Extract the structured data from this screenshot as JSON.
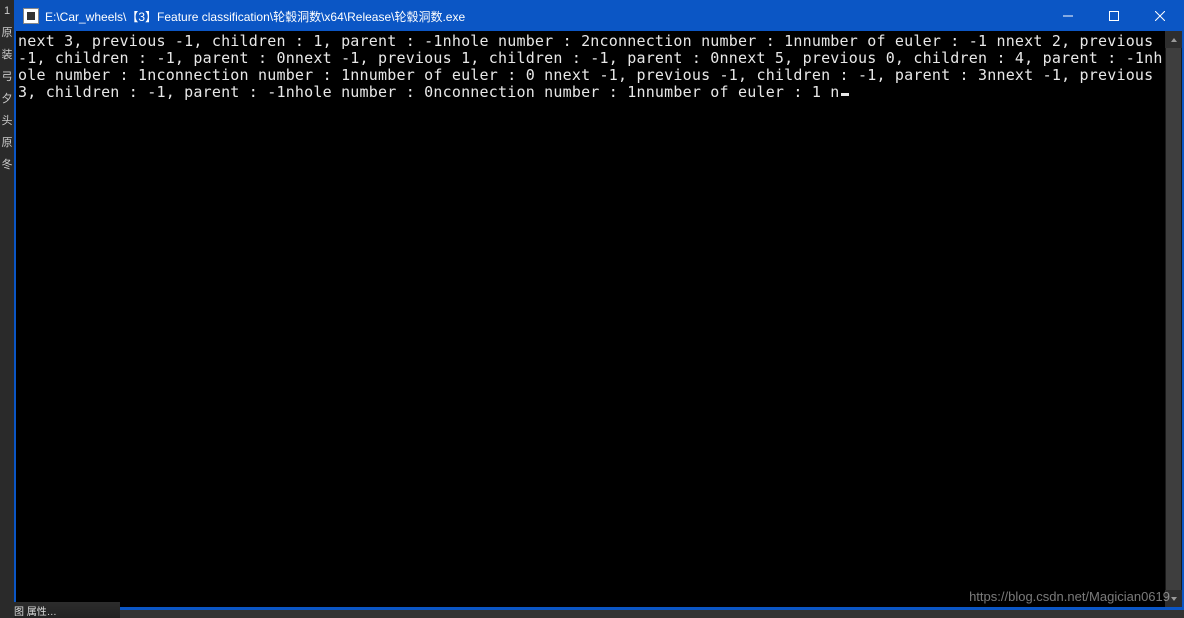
{
  "window": {
    "title": "E:\\Car_wheels\\【3】Feature classification\\轮毂洞数\\x64\\Release\\轮毂洞数.exe"
  },
  "console": {
    "output": "next 3, previous -1, children : 1, parent : -1nhole number : 2nconnection number : 1nnumber of euler : -1 nnext 2, previous -1, children : -1, parent : 0nnext -1, previous 1, children : -1, parent : 0nnext 5, previous 0, children : 4, parent : -1nhole number : 1nconnection number : 1nnumber of euler : 0 nnext -1, previous -1, children : -1, parent : 3nnext -1, previous 3, children : -1, parent : -1nhole number : 0nconnection number : 1nnumber of euler : 1 n"
  },
  "left_strip": {
    "items": [
      "1",
      "原",
      "装",
      "弓",
      "夕",
      "头",
      "原",
      "冬"
    ]
  },
  "taskbar": {
    "text": "视图  属性…"
  },
  "watermark": "https://blog.csdn.net/Magician0619"
}
